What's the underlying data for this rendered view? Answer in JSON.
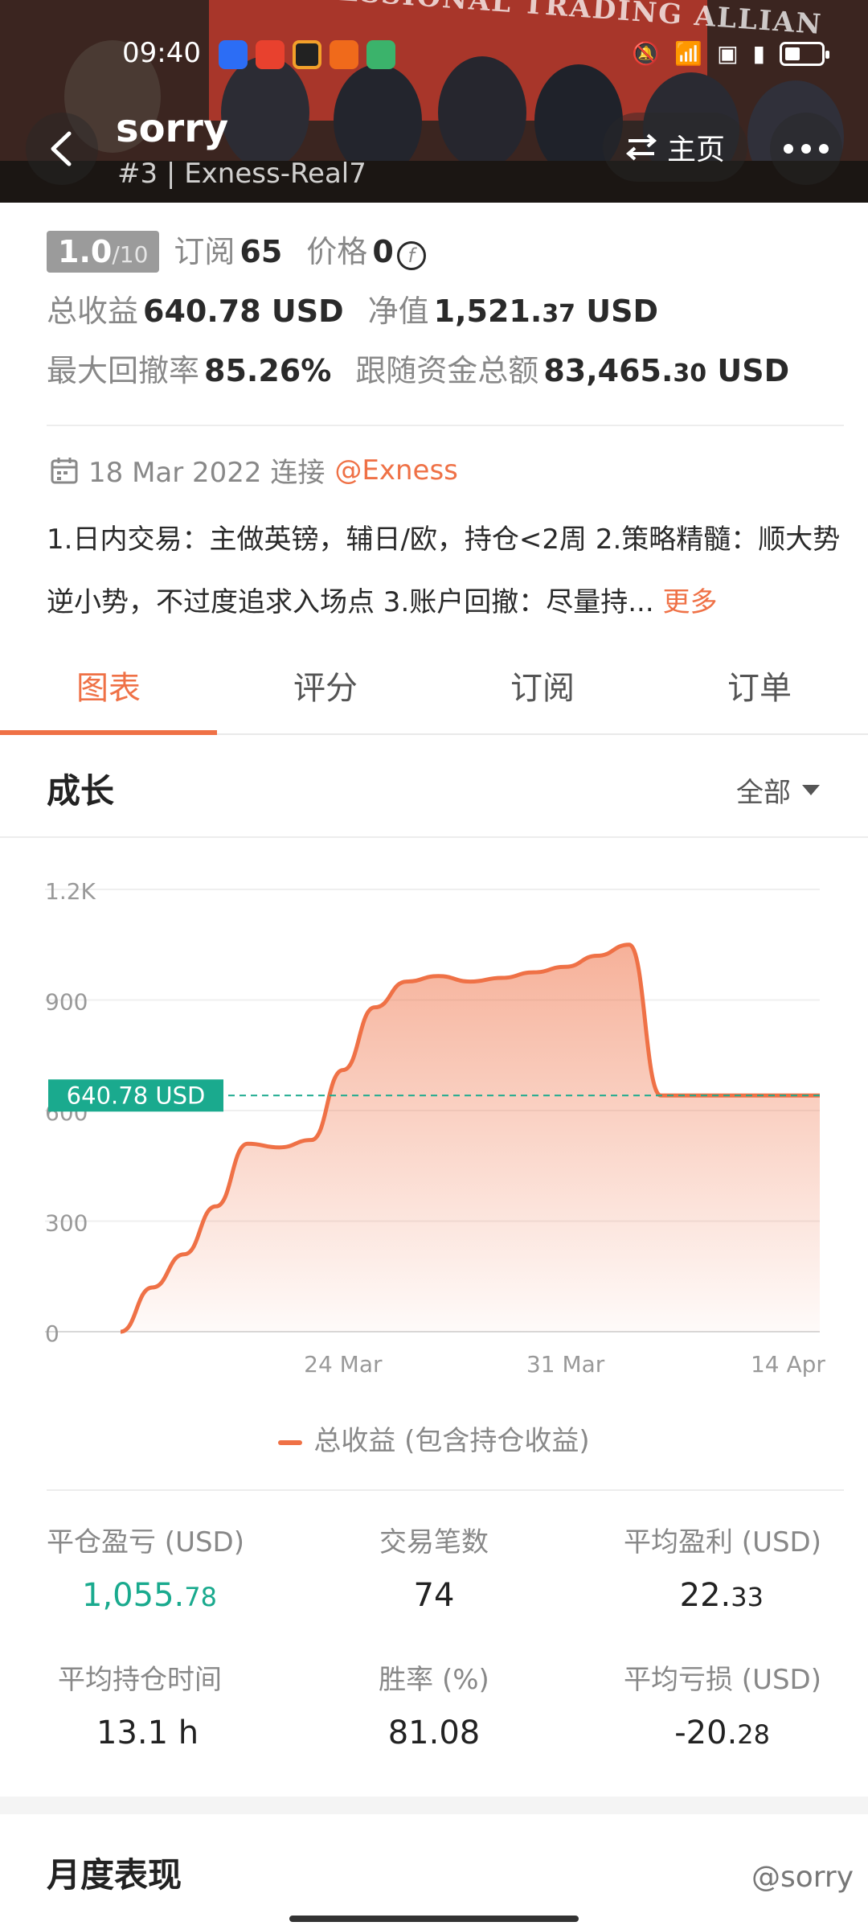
{
  "status_bar": {
    "time": "09:40",
    "battery_level": 0.3
  },
  "banner": {
    "text": "ESSIONAL TRADING ALLIAN"
  },
  "header": {
    "trader_name": "sorry",
    "trader_sub": "#3 | Exness-Real7",
    "home_label": "主页"
  },
  "summary": {
    "score": "1.0",
    "score_max": "/10",
    "subscribe_label": "订阅",
    "subscribe_count": "65",
    "price_label": "价格",
    "price_value": "0",
    "total_profit_label": "总收益",
    "total_profit_main": "640.78",
    "total_profit_unit": " USD",
    "equity_label": "净值",
    "equity_main": "1,521.",
    "equity_cents": "37",
    "equity_unit": " USD",
    "drawdown_label": "最大回撤率",
    "drawdown_value": "85.26%",
    "follow_label": "跟随资金总额",
    "follow_main": "83,465.",
    "follow_cents": "30",
    "follow_unit": " USD"
  },
  "connect": {
    "date": "18 Mar 2022 连接",
    "broker": "@Exness"
  },
  "description": {
    "text": "1.日内交易：主做英镑，辅日/欧，持仓<2周 2.策略精髓：顺大势逆小势，不过度追求入场点 3.账户回撤：尽量持...",
    "more_label": "更多"
  },
  "tabs": [
    {
      "label": "图表",
      "active": true
    },
    {
      "label": "评分",
      "active": false
    },
    {
      "label": "订阅",
      "active": false
    },
    {
      "label": "订单",
      "active": false
    }
  ],
  "growth": {
    "title": "成长",
    "range_label": "全部"
  },
  "chart_data": {
    "type": "area",
    "y_ticks": [
      "0",
      "300",
      "600",
      "900",
      "1.2K"
    ],
    "ylim": [
      0,
      1200
    ],
    "x_ticks": [
      {
        "day": 7,
        "label": "24 Mar"
      },
      {
        "day": 14,
        "label": "31 Mar"
      },
      {
        "day": 21,
        "label": "14 Apr"
      }
    ],
    "series": [
      {
        "name": "总收益 (包含持仓收益)",
        "color": "#ef7146",
        "x": [
          0,
          1,
          2,
          3,
          4,
          5,
          6,
          7,
          8,
          9,
          10,
          11,
          12,
          13,
          14,
          15,
          16,
          17,
          18,
          19,
          20,
          21,
          22
        ],
        "values": [
          0,
          120,
          210,
          340,
          510,
          500,
          520,
          710,
          880,
          950,
          965,
          950,
          960,
          975,
          990,
          1020,
          1050,
          640.78,
          640.78,
          640.78,
          640.78,
          640.78,
          640.78
        ]
      }
    ],
    "reference_value": 640.78,
    "reference_label": "640.78 USD",
    "grid": true
  },
  "legend": {
    "label": "总收益 (包含持仓收益)"
  },
  "stats": [
    {
      "label": "平仓盈亏 (USD)",
      "main": "1,055.",
      "cents": "78",
      "green": true
    },
    {
      "label": "交易笔数",
      "main": "74",
      "cents": "",
      "green": false
    },
    {
      "label": "平均盈利 (USD)",
      "main": "22.",
      "cents": "33",
      "green": false
    },
    {
      "label": "平均持仓时间",
      "main": "13.1 h",
      "cents": "",
      "green": false
    },
    {
      "label": "胜率 (%)",
      "main": "81.08",
      "cents": "",
      "green": false
    },
    {
      "label": "平均亏损 (USD)",
      "main": "-20.",
      "cents": "28",
      "green": false
    }
  ],
  "monthly": {
    "title": "月度表现"
  },
  "watermark": "@sorry"
}
